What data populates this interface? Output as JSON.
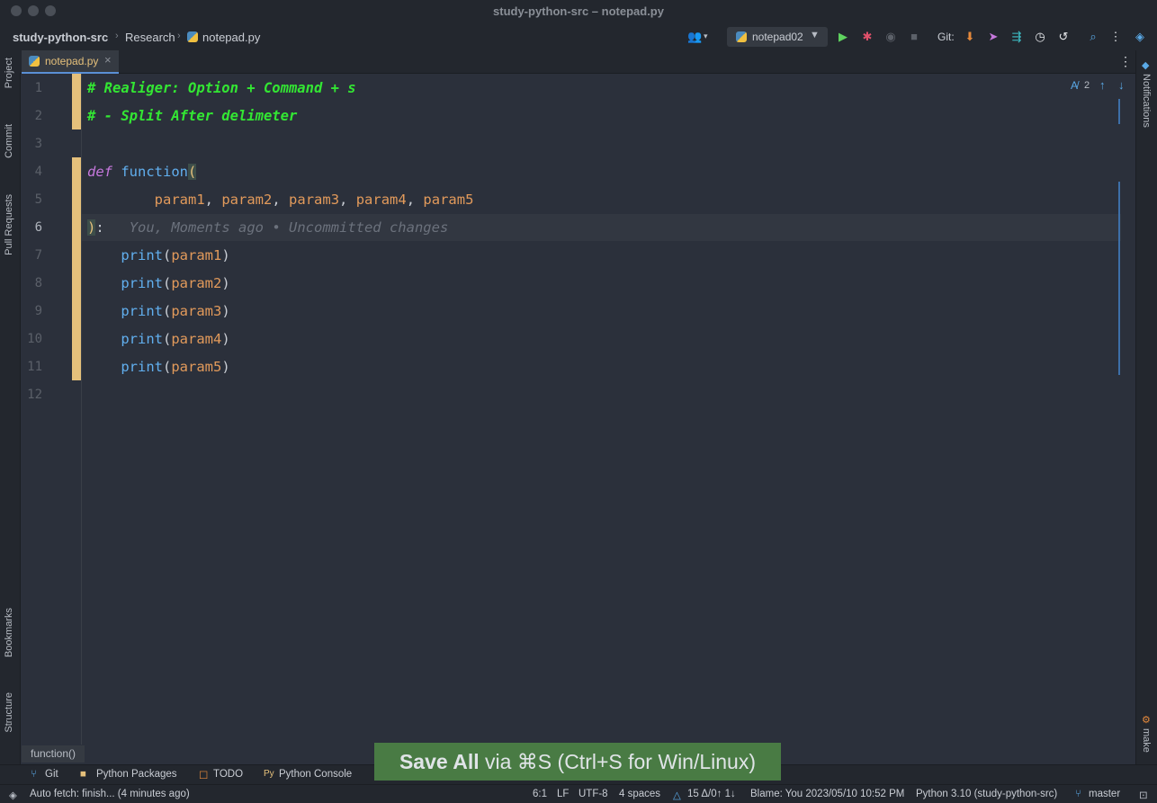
{
  "window": {
    "title": "study-python-src – notepad.py"
  },
  "navbar": {
    "project": "study-python-src",
    "folder": "Research",
    "file": "notepad.py",
    "run_config": "notepad02",
    "git_label": "Git:"
  },
  "tabs": [
    {
      "label": "notepad.py",
      "close": "×"
    }
  ],
  "left_tools": [
    "Project",
    "Commit",
    "Pull Requests",
    "Bookmarks",
    "Structure"
  ],
  "right_tools": [
    "Notifications",
    "make"
  ],
  "editor": {
    "inspection_count": "2",
    "lines": [
      "1",
      "2",
      "3",
      "4",
      "5",
      "6",
      "7",
      "8",
      "9",
      "10",
      "11",
      "12"
    ],
    "code": {
      "l1": "# Realiger: Option + Command + s",
      "l2": "# - Split After delimeter",
      "l4_kw": "def",
      "l4_fn": "function",
      "l4_paren": "(",
      "l5_p1": "param1",
      "l5_p2": "param2",
      "l5_p3": "param3",
      "l5_p4": "param4",
      "l5_p5": "param5",
      "comma": ",",
      "l6_close": ")",
      "l6_colon": ":",
      "blame": "You, Moments ago • Uncommitted changes",
      "print": "print",
      "prints": [
        "param1",
        "param2",
        "param3",
        "param4",
        "param5"
      ]
    }
  },
  "breadcrumb": "function()",
  "bottom_tools": [
    "Git",
    "Python Packages",
    "TODO",
    "Python Console"
  ],
  "toast": {
    "bold": "Save All",
    "rest": " via ⌘S (Ctrl+S for Win/Linux)"
  },
  "status": {
    "left": "Auto fetch: finish... (4 minutes ago)",
    "position": "6:1",
    "line_sep": "LF",
    "encoding": "UTF-8",
    "indent": "4 spaces",
    "vcs": "15 Δ/0↑ 1↓",
    "blame": "Blame: You 2023/05/10 10:52 PM",
    "interpreter": "Python 3.10 (study-python-src)",
    "branch": "master"
  },
  "colors": {
    "comment": "#33e633",
    "keyword": "#c678dd",
    "function": "#61afef",
    "param": "#e29a5b",
    "vcs_modified": "#e5c07b",
    "toast_bg": "#4b7f45"
  }
}
